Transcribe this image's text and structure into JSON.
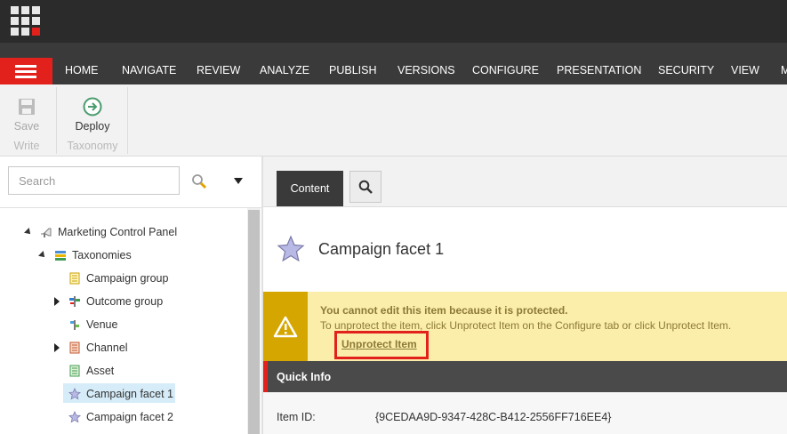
{
  "nav": {
    "tabs": [
      "HOME",
      "NAVIGATE",
      "REVIEW",
      "ANALYZE",
      "PUBLISH",
      "VERSIONS",
      "CONFIGURE",
      "PRESENTATION",
      "SECURITY",
      "VIEW",
      "M"
    ]
  },
  "toolbar": {
    "save_label": "Save",
    "write_group": "Write",
    "deploy_label": "Deploy",
    "taxonomy_group": "Taxonomy"
  },
  "search": {
    "placeholder": "Search"
  },
  "tree": {
    "items": [
      {
        "label": "Marketing Control Panel",
        "icon": "control-panel-icon"
      },
      {
        "label": "Taxonomies",
        "icon": "books-icon"
      },
      {
        "label": "Campaign group",
        "icon": "document-yellow-icon"
      },
      {
        "label": "Outcome group",
        "icon": "signpost-icon"
      },
      {
        "label": "Venue",
        "icon": "venue-icon"
      },
      {
        "label": "Channel",
        "icon": "channel-book-icon"
      },
      {
        "label": "Asset",
        "icon": "document-green-icon"
      },
      {
        "label": "Campaign facet 1",
        "icon": "star-icon"
      },
      {
        "label": "Campaign facet 2",
        "icon": "star-icon"
      }
    ]
  },
  "content": {
    "tab_label": "Content",
    "title": "Campaign facet 1",
    "warning_title": "You cannot edit this item because it is protected.",
    "warning_body": "To unprotect the item, click Unprotect Item on the Configure tab or click Unprotect Item.",
    "unprotect_link": "Unprotect Item",
    "quick_info": "Quick Info",
    "item_id_label": "Item ID:",
    "item_id_value": "{9CEDAA9D-9347-428C-B412-2556FF716EE4}"
  },
  "colors": {
    "accent": "#e3211c",
    "warning_bg": "#fbeeaa",
    "warning_icon_bg": "#d6a600"
  }
}
